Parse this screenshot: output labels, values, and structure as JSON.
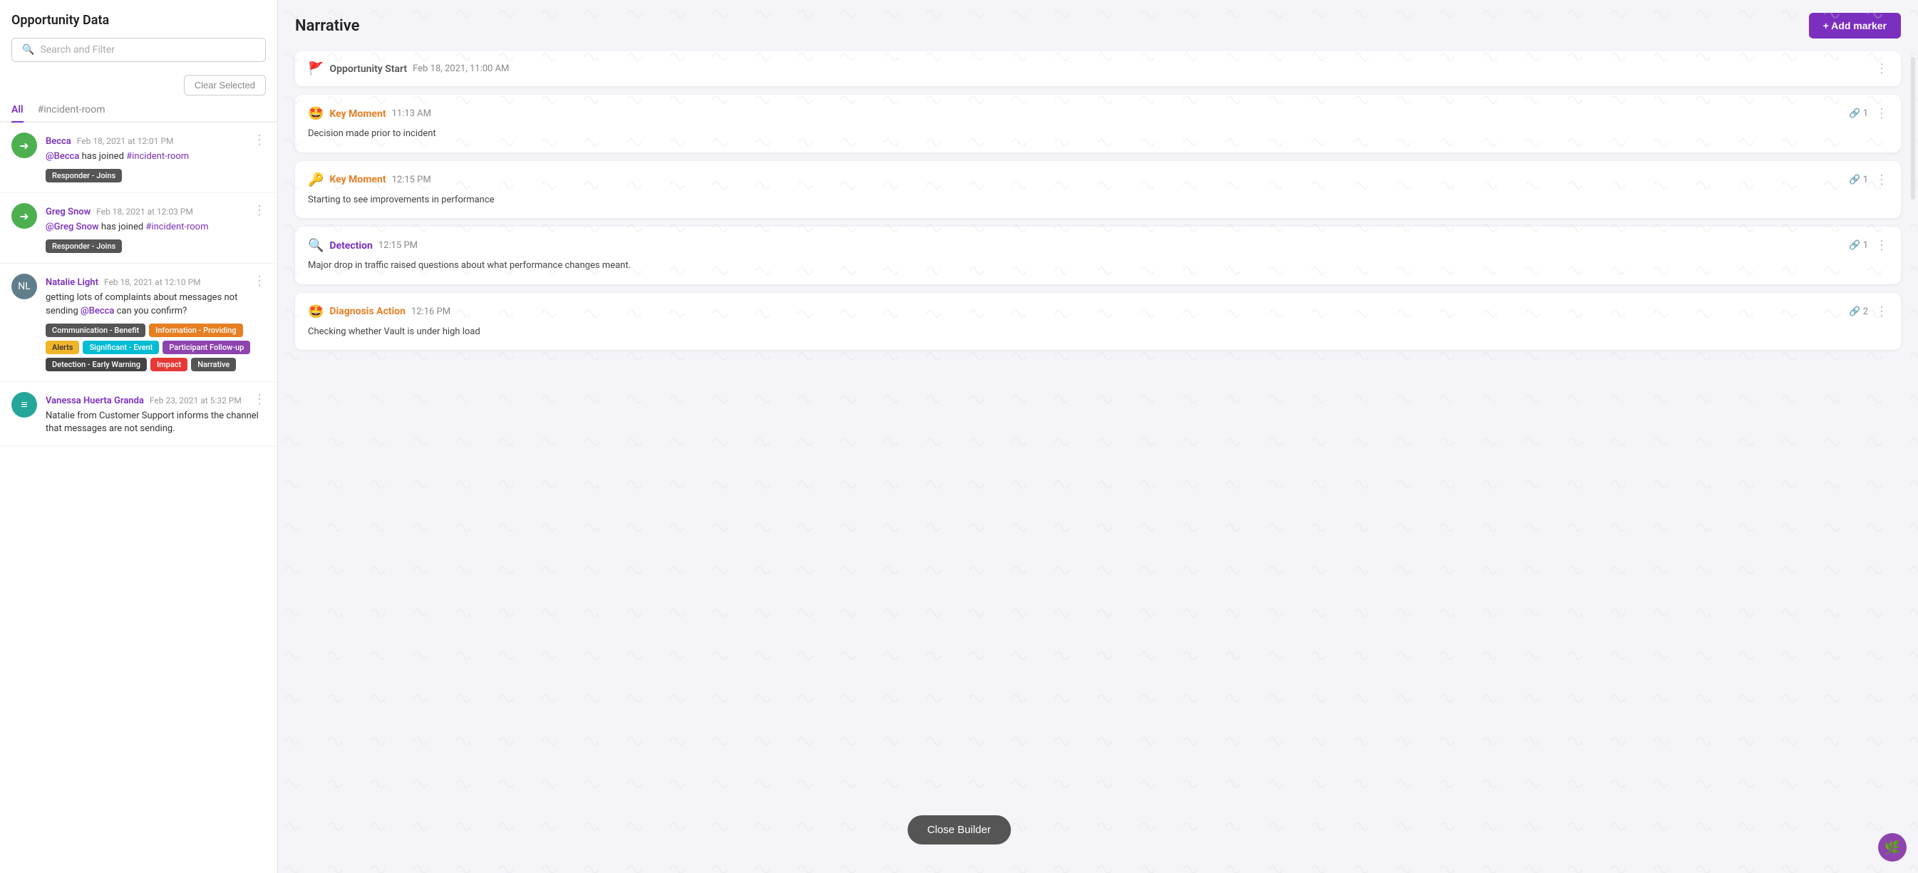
{
  "left": {
    "title": "Opportunity Data",
    "search": {
      "placeholder": "Search and Filter"
    },
    "clear_button": "Clear Selected",
    "tabs": [
      {
        "label": "All",
        "active": true
      },
      {
        "label": "#incident-room",
        "active": false
      }
    ],
    "messages": [
      {
        "id": "msg1",
        "author": "Becca",
        "time": "Feb 18, 2021 at 12:01 PM",
        "avatar_type": "icon",
        "avatar_icon": "→",
        "avatar_color": "#4caf50",
        "body_parts": [
          {
            "type": "mention",
            "text": "@Becca"
          },
          {
            "type": "text",
            "text": " has joined "
          },
          {
            "type": "channel",
            "text": "#incident-room"
          }
        ],
        "tags": [
          {
            "label": "Responder - Joins",
            "color": "gray"
          }
        ]
      },
      {
        "id": "msg2",
        "author": "Greg Snow",
        "time": "Feb 18, 2021 at 12:03 PM",
        "avatar_type": "icon",
        "avatar_icon": "→",
        "avatar_color": "#4caf50",
        "body_parts": [
          {
            "type": "mention",
            "text": "@Greg Snow"
          },
          {
            "type": "text",
            "text": " has joined "
          },
          {
            "type": "channel",
            "text": "#incident-room"
          }
        ],
        "tags": [
          {
            "label": "Responder - Joins",
            "color": "gray"
          }
        ]
      },
      {
        "id": "msg3",
        "author": "Natalie Light",
        "time": "Feb 18, 2021 at 12:10 PM",
        "avatar_type": "img",
        "avatar_color": "#607d8b",
        "body_parts": [
          {
            "type": "text",
            "text": "getting lots of complaints about messages not sending "
          },
          {
            "type": "mention",
            "text": "@Becca"
          },
          {
            "type": "text",
            "text": " can you confirm?"
          }
        ],
        "tags": [
          {
            "label": "Communication - Benefit",
            "color": "gray"
          },
          {
            "label": "Information - Providing",
            "color": "orange"
          },
          {
            "label": "Alerts",
            "color": "yellow"
          },
          {
            "label": "Significant - Event",
            "color": "cyan"
          },
          {
            "label": "Participant Follow-up",
            "color": "purple"
          },
          {
            "label": "Detection - Early Warning",
            "color": "dark"
          },
          {
            "label": "Impact",
            "color": "red"
          },
          {
            "label": "Narrative",
            "color": "charcoal"
          }
        ]
      },
      {
        "id": "msg4",
        "author": "Vanessa Huerta Granda",
        "time": "Feb 23, 2021 at 5:32 PM",
        "avatar_type": "icon",
        "avatar_icon": "≡",
        "avatar_color": "#26a69a",
        "body_parts": [
          {
            "type": "text",
            "text": "Natalie from Customer Support informs the channel that messages are not sending."
          }
        ],
        "tags": []
      }
    ]
  },
  "right": {
    "title": "Narrative",
    "add_marker_label": "+ Add marker",
    "cards": [
      {
        "id": "card1",
        "type": "opportunity_start",
        "emoji": "🚩",
        "type_label": "Opportunity Start",
        "time": "Feb 18, 2021, 11:00 AM",
        "has_links": false,
        "link_count": null,
        "body": null
      },
      {
        "id": "card2",
        "type": "key_moment",
        "emoji": "🤩",
        "type_label": "Key Moment",
        "time": "11:13 AM",
        "has_links": true,
        "link_count": 1,
        "body": "Decision made prior to incident"
      },
      {
        "id": "card3",
        "type": "key_moment",
        "emoji": "🔑",
        "type_label": "Key Moment",
        "time": "12:15 PM",
        "has_links": true,
        "link_count": 1,
        "body": "Starting to see improvements in performance"
      },
      {
        "id": "card4",
        "type": "detection",
        "emoji": "🔍",
        "type_label": "Detection",
        "time": "12:15 PM",
        "has_links": true,
        "link_count": 1,
        "body": "Major drop in traffic raised questions about what performance changes meant."
      },
      {
        "id": "card5",
        "type": "diagnosis_action",
        "emoji": "🤩",
        "type_label": "Diagnosis Action",
        "time": "12:16 PM",
        "has_links": true,
        "link_count": 2,
        "body": "Checking whether Vault is under high load"
      }
    ],
    "close_builder_label": "Close Builder"
  }
}
